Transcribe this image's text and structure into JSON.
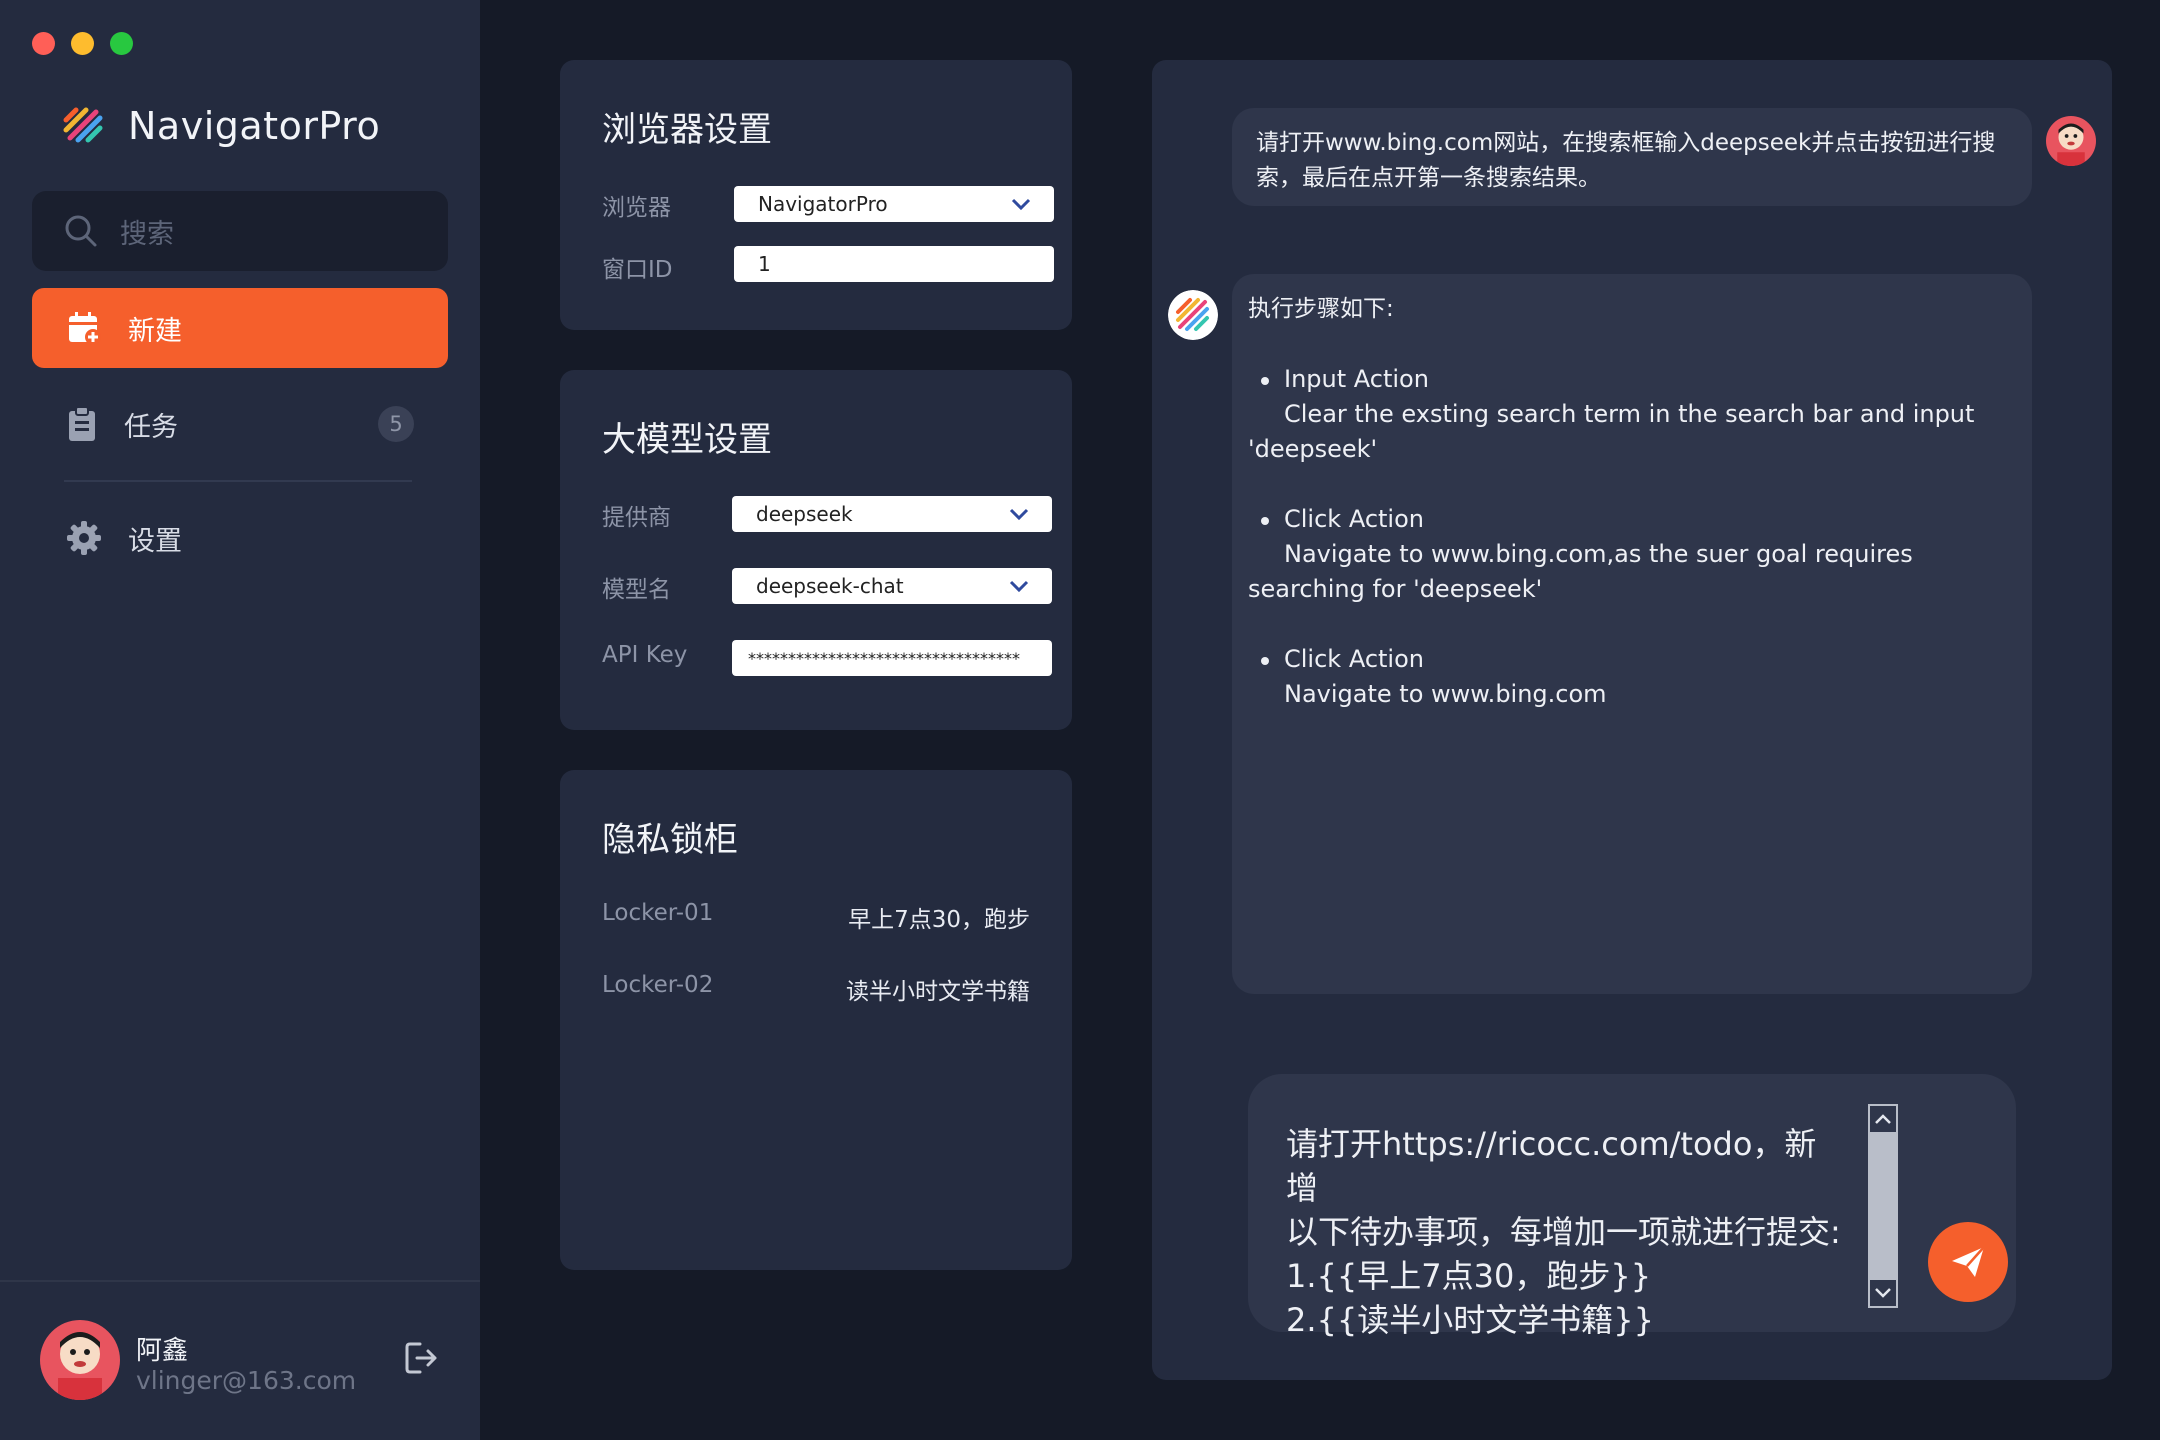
{
  "app": {
    "name": "NavigatorPro"
  },
  "sidebar": {
    "search_placeholder": "搜索",
    "items": [
      {
        "label": "新建",
        "icon": "calendar-plus-icon",
        "active": true
      },
      {
        "label": "任务",
        "icon": "clipboard-icon",
        "badge": "5"
      },
      {
        "label": "设置",
        "icon": "gear-icon"
      }
    ],
    "user": {
      "name": "阿鑫",
      "email": "vlinger@163.com"
    }
  },
  "browser_settings": {
    "title": "浏览器设置",
    "browser_label": "浏览器",
    "browser_value": "NavigatorPro",
    "window_label": "窗口ID",
    "window_value": "1"
  },
  "model_settings": {
    "title": "大模型设置",
    "provider_label": "提供商",
    "provider_value": "deepseek",
    "model_label": "模型名",
    "model_value": "deepseek-chat",
    "apikey_label": "API Key",
    "apikey_value": "**********************************"
  },
  "locker": {
    "title": "隐私锁柜",
    "items": [
      {
        "key": "Locker-01",
        "value": "早上7点30，跑步"
      },
      {
        "key": "Locker-02",
        "value": "读半小时文学书籍"
      }
    ]
  },
  "chat": {
    "user_message": "请打开www.bing.com网站，在搜索框输入deepseek并点击按钮进行搜索，最后在点开第一条搜索结果。",
    "bot_heading": "执行步骤如下:",
    "steps": [
      {
        "title": "Input Action",
        "desc": "Clear the exsting search term in the search bar and input 'deepseek'"
      },
      {
        "title": "Click Action",
        "desc": "Navigate to www.bing.com,as the suer goal requires searching for 'deepseek'"
      },
      {
        "title": "Click Action",
        "desc": "Navigate to www.bing.com"
      }
    ],
    "composer_lines": [
      "请打开https://ricocc.com/todo，新增",
      "以下待办事项，每增加一项就进行提交:",
      "1.{{早上7点30，跑步}}",
      "2.{{读半小时文学书籍}}"
    ]
  },
  "colors": {
    "accent": "#f55f2c",
    "sidebar_bg": "#242b3f",
    "app_bg": "#151a27",
    "bubble_bg": "#2f364b"
  }
}
